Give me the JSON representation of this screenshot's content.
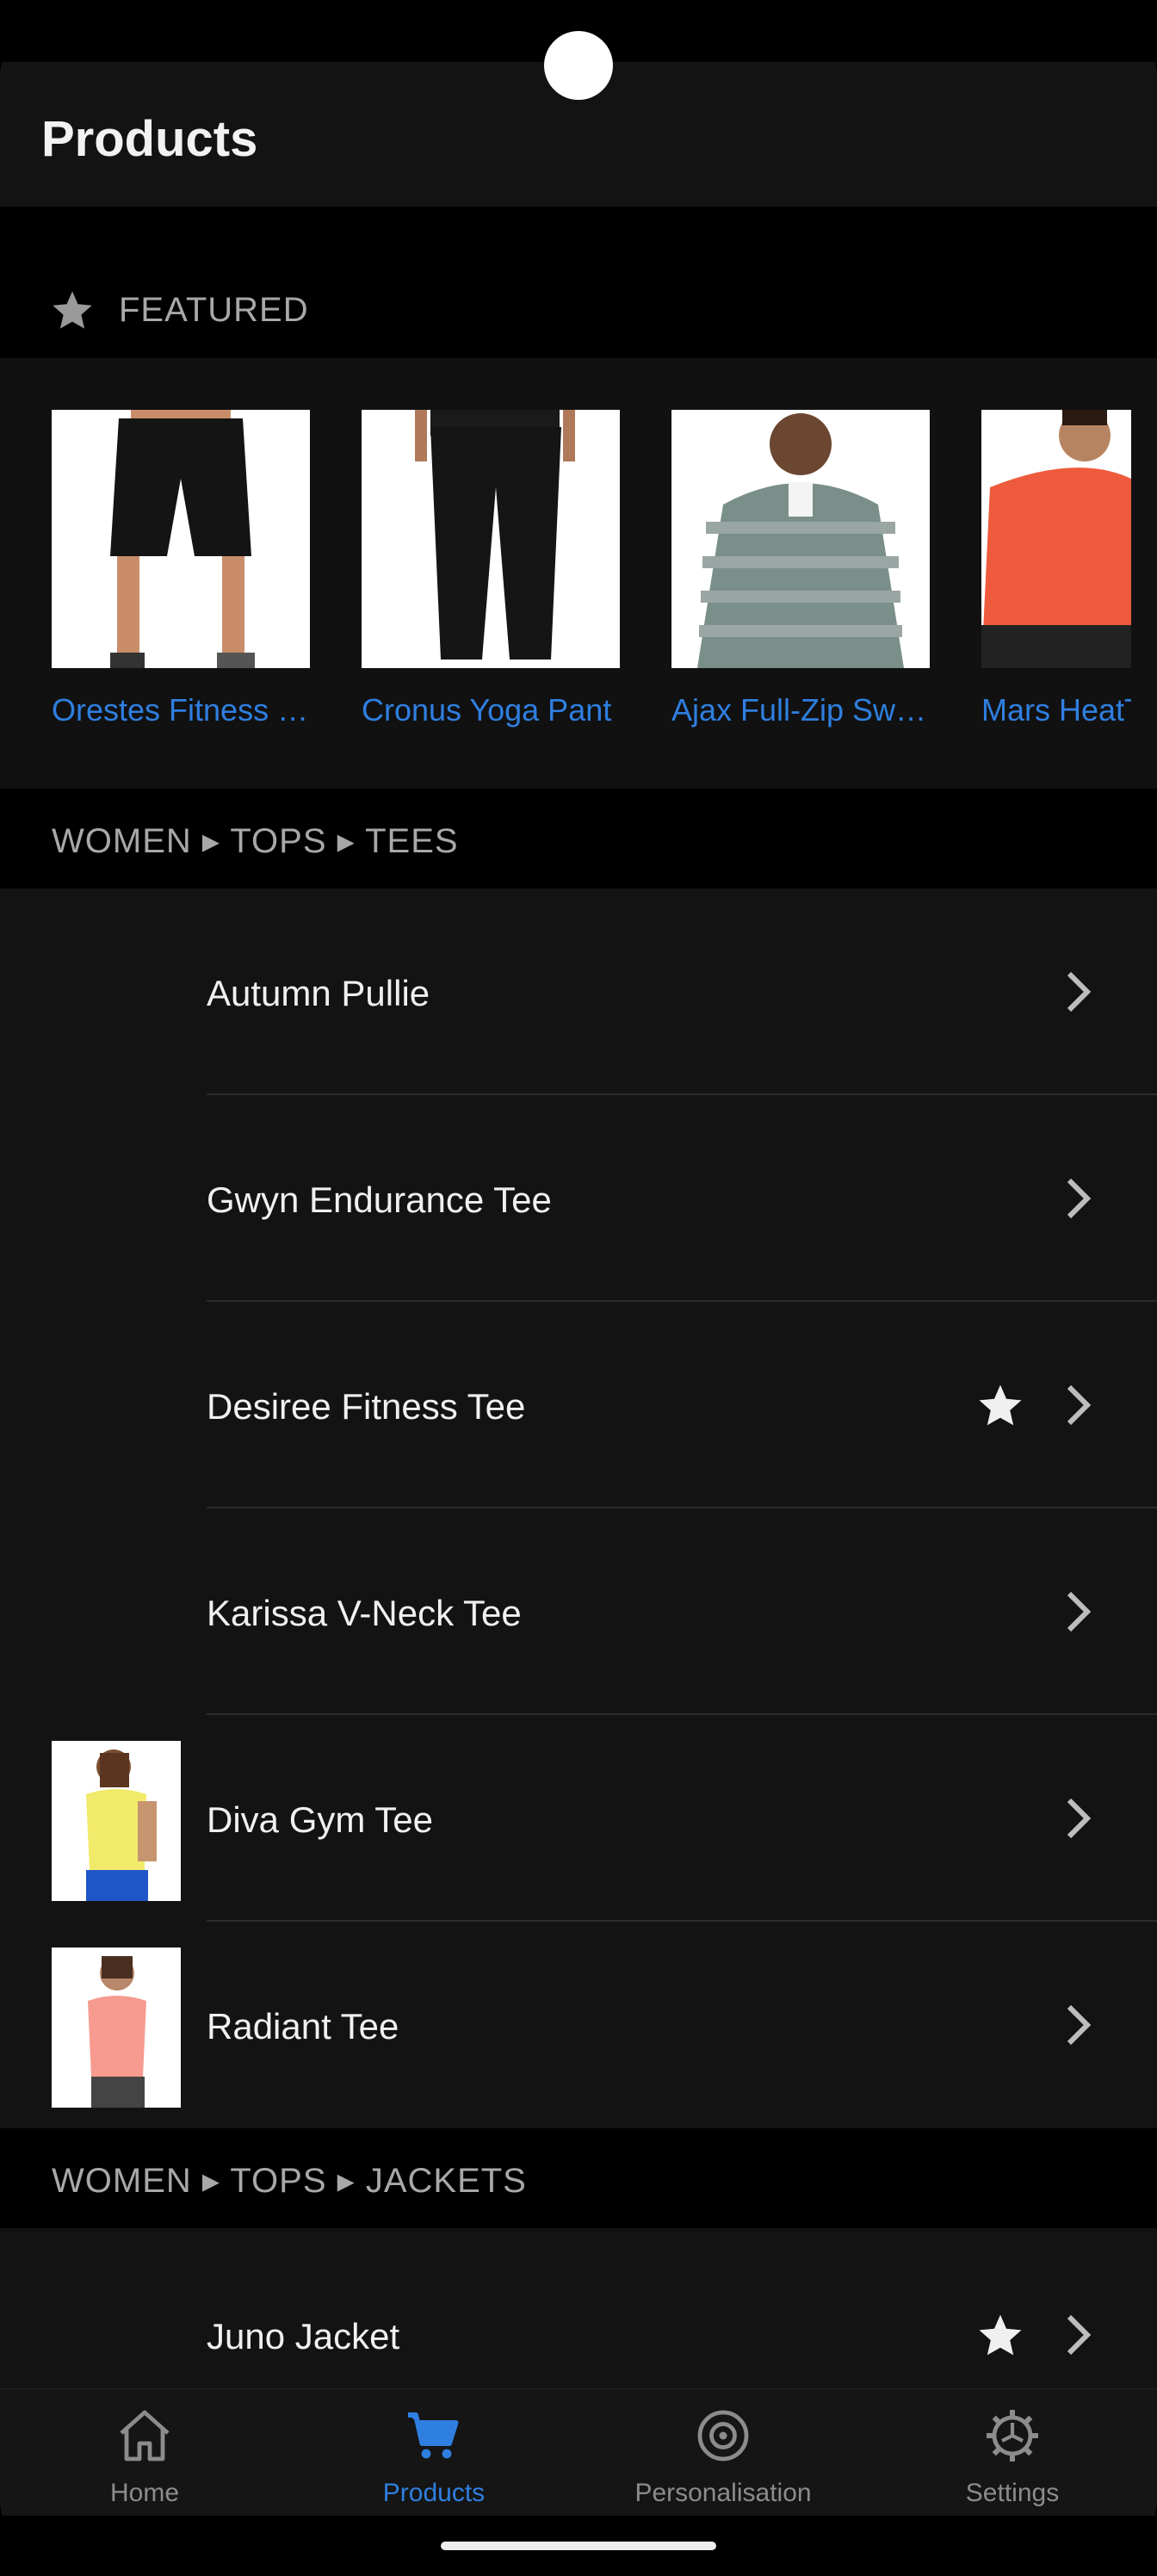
{
  "app_bar": {
    "title": "Products"
  },
  "featured": {
    "label": "FEATURED",
    "items": [
      {
        "title": "Orestes Fitness …"
      },
      {
        "title": "Cronus Yoga Pant"
      },
      {
        "title": "Ajax Full-Zip Swe…"
      },
      {
        "title": "Mars HeatT"
      }
    ]
  },
  "sections": [
    {
      "breadcrumb": "WOMEN ▸ TOPS ▸ TEES",
      "rows": [
        {
          "label": "Autumn Pullie",
          "favorite": false,
          "has_image": false
        },
        {
          "label": "Gwyn Endurance Tee",
          "favorite": false,
          "has_image": false
        },
        {
          "label": "Desiree Fitness Tee",
          "favorite": true,
          "has_image": false
        },
        {
          "label": "Karissa V-Neck Tee",
          "favorite": false,
          "has_image": false
        },
        {
          "label": "Diva Gym Tee",
          "favorite": false,
          "has_image": true
        },
        {
          "label": "Radiant Tee",
          "favorite": false,
          "has_image": true
        }
      ]
    },
    {
      "breadcrumb": "WOMEN ▸ TOPS ▸ JACKETS",
      "rows": [
        {
          "label": "Juno Jacket",
          "favorite": true,
          "has_image": false
        }
      ]
    }
  ],
  "bottom_nav": {
    "items": [
      {
        "label": "Home",
        "icon": "home-icon",
        "active": false
      },
      {
        "label": "Products",
        "icon": "cart-icon",
        "active": true
      },
      {
        "label": "Personalisation",
        "icon": "target-icon",
        "active": false
      },
      {
        "label": "Settings",
        "icon": "gear-icon",
        "active": false
      }
    ]
  },
  "colors": {
    "accent": "#2f7fe0",
    "background": "#111111",
    "header": "#000000"
  }
}
